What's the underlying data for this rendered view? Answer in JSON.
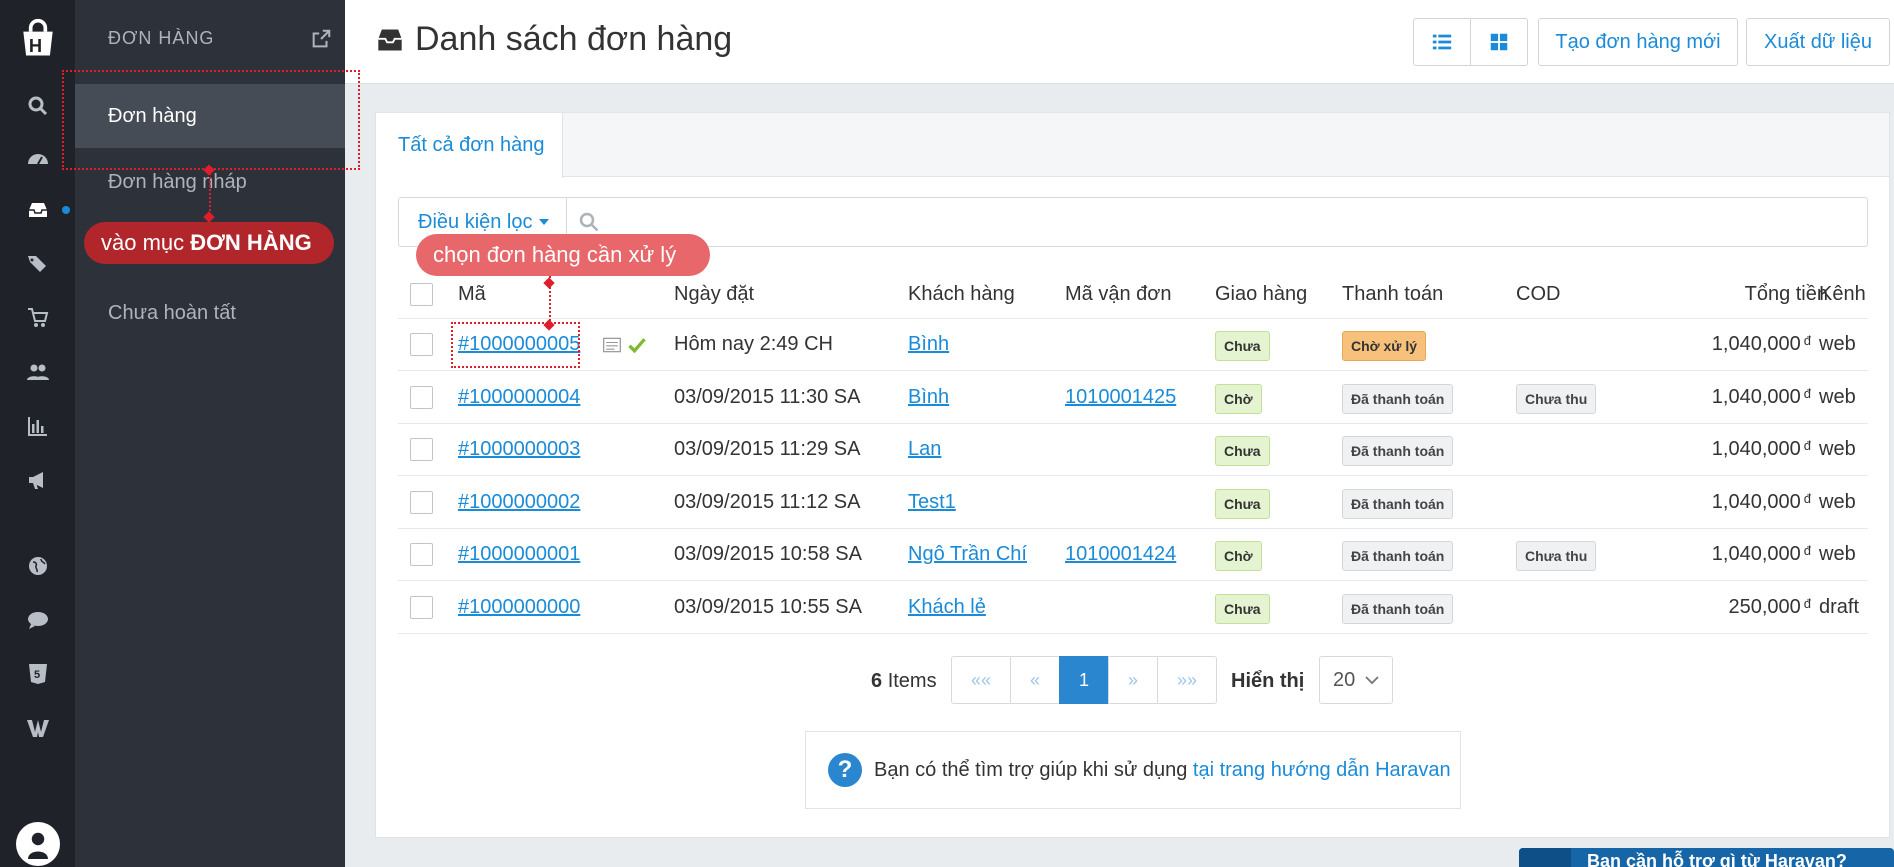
{
  "iconbar": {
    "icons": [
      "logo-icon",
      "search-icon",
      "dashboard-icon",
      "orders-inbox-icon",
      "tags-icon",
      "cart-icon",
      "customers-icon",
      "reports-icon",
      "marketing-icon",
      "globe-icon",
      "chat-icon",
      "html5-icon",
      "w-icon",
      "user-avatar"
    ],
    "active_color": "#1a8bd8"
  },
  "subnav": {
    "heading": "ĐƠN HÀNG",
    "items": [
      {
        "label": "Đơn hàng",
        "active": true
      },
      {
        "label": "Đơn hàng nháp",
        "active": false
      },
      {
        "label": "Chưa hoàn tất",
        "active": false
      }
    ]
  },
  "header": {
    "title": "Danh sách đơn hàng",
    "create_label": "Tạo đơn hàng mới",
    "export_label": "Xuất dữ liệu"
  },
  "tabs": [
    "Tất cả đơn hàng"
  ],
  "filter": {
    "label": "Điều kiện lọc"
  },
  "table": {
    "columns": [
      "Mã",
      "Ngày đặt",
      "Khách hàng",
      "Mã vận đơn",
      "Giao hàng",
      "Thanh toán",
      "COD",
      "Tổng tiền",
      "Kênh"
    ],
    "currency": "đ",
    "rows": [
      {
        "code": "#1000000005",
        "date": "Hôm nay 2:49 CH",
        "customer": "Bình",
        "tracking": "",
        "shipping": "Chưa",
        "payment": "Chờ xử lý",
        "payment_style": "orange",
        "cod": "",
        "total": "1,040,000",
        "channel": "web",
        "flags": true
      },
      {
        "code": "#1000000004",
        "date": "03/09/2015 11:30 SA",
        "customer": "Bình",
        "tracking": "1010001425",
        "shipping": "Chờ",
        "payment": "Đã thanh toán",
        "payment_style": "grey",
        "cod": "Chưa thu",
        "total": "1,040,000",
        "channel": "web",
        "flags": false
      },
      {
        "code": "#1000000003",
        "date": "03/09/2015 11:29 SA",
        "customer": "Lan",
        "tracking": "",
        "shipping": "Chưa",
        "payment": "Đã thanh toán",
        "payment_style": "grey",
        "cod": "",
        "total": "1,040,000",
        "channel": "web",
        "flags": false
      },
      {
        "code": "#1000000002",
        "date": "03/09/2015 11:12 SA",
        "customer": "Test1",
        "tracking": "",
        "shipping": "Chưa",
        "payment": "Đã thanh toán",
        "payment_style": "grey",
        "cod": "",
        "total": "1,040,000",
        "channel": "web",
        "flags": false
      },
      {
        "code": "#1000000001",
        "date": "03/09/2015 10:58 SA",
        "customer": "Ngô Trần Chí",
        "tracking": "1010001424",
        "shipping": "Chờ",
        "payment": "Đã thanh toán",
        "payment_style": "grey",
        "cod": "Chưa thu",
        "total": "1,040,000",
        "channel": "web",
        "flags": false
      },
      {
        "code": "#1000000000",
        "date": "03/09/2015 10:55 SA",
        "customer": "Khách lẻ",
        "tracking": "",
        "shipping": "Chưa",
        "payment": "Đã thanh toán",
        "payment_style": "grey",
        "cod": "",
        "total": "250,000",
        "channel": "draft",
        "flags": false
      }
    ]
  },
  "pagination": {
    "count": "6",
    "items_label": "Items",
    "first": "««",
    "prev": "«",
    "current": "1",
    "next": "»",
    "last": "»»",
    "show_label": "Hiển thị",
    "page_size": "20"
  },
  "help": {
    "text": "Bạn có thể tìm trợ giúp khi sử dụng",
    "link": "tại trang hướng dẫn Haravan"
  },
  "annotations": {
    "note1_prefix": "vào mục",
    "note1_bold": "ĐƠN HÀNG",
    "note2": "chọn đơn hàng cần xử lý"
  },
  "chat": {
    "label": "Bạn cần hỗ trợ gì từ Haravan?"
  }
}
